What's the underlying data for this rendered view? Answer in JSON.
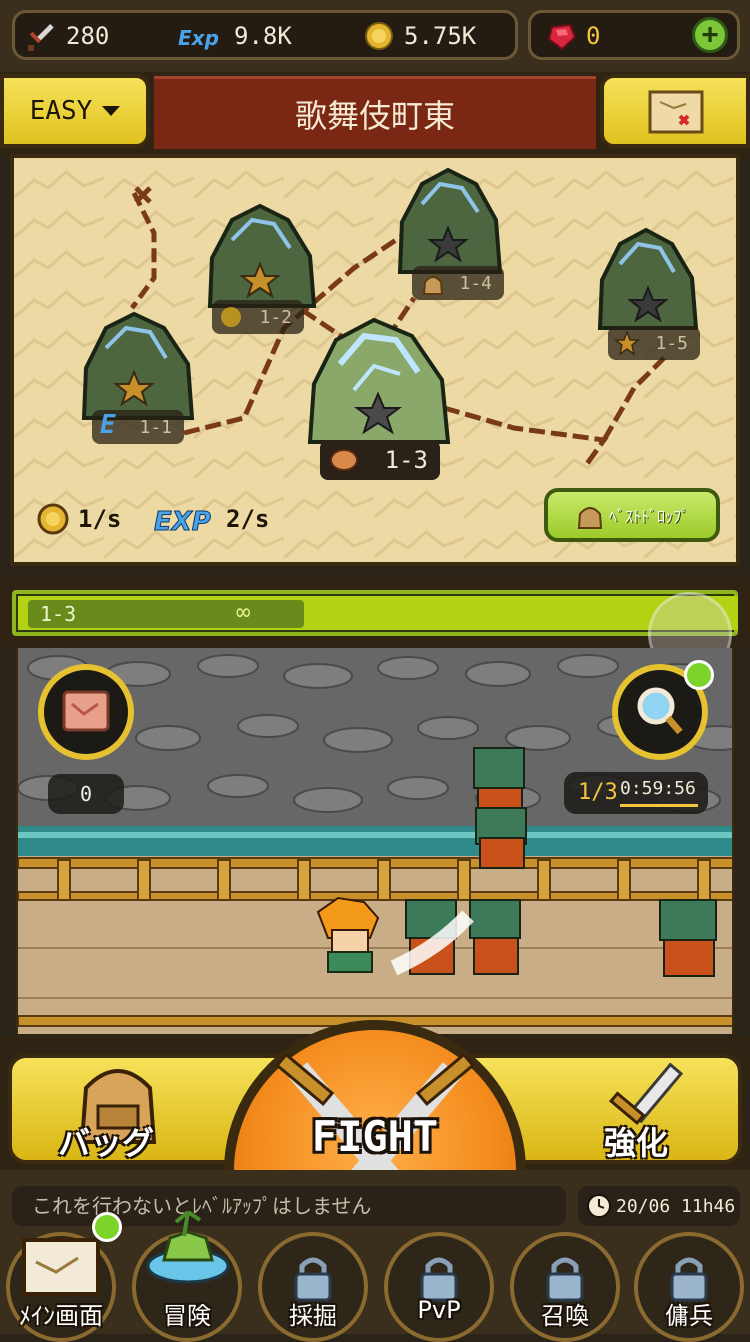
{
  "resources": {
    "attack": "280",
    "exp": "9.8K",
    "gold": "5.75K",
    "gems": "0",
    "attack_icon": "sword-icon",
    "exp_icon": "exp-icon",
    "gold_icon": "coin-icon",
    "gem_icon": "ruby-icon",
    "add_icon": "plus-icon"
  },
  "header": {
    "difficulty": "EASY",
    "area_title": "歌舞伎町東",
    "map_icon": "treasure-map-icon"
  },
  "map": {
    "nodes": [
      {
        "label": "1-1",
        "star": "gold-star",
        "badge": "E"
      },
      {
        "label": "1-2",
        "star": "gold-star",
        "badge": "coin"
      },
      {
        "label": "1-3",
        "star": "dark-star",
        "badge": "meat",
        "active": true
      },
      {
        "label": "1-4",
        "star": "dark-star",
        "badge": "bag"
      },
      {
        "label": "1-5",
        "star": "dark-star",
        "badge": "star"
      }
    ],
    "gold_rate": "1/s",
    "exp_rate": "2/s",
    "best_drop": "ﾍﾞｽﾄﾄﾞﾛｯﾌﾟ"
  },
  "progress": {
    "stage": "1-3",
    "infinite_symbol": "∞",
    "fill_percent": 100
  },
  "battle": {
    "meat_count": "0",
    "wave": "1/3",
    "timer": "0:59:56"
  },
  "actions": {
    "bag": "バッグ",
    "fight": "FIGHT",
    "upgrade": "強化"
  },
  "status": {
    "message": "これを行わないとﾚﾍﾞﾙｱｯﾌﾟはしません",
    "clock": "20/06 11h46"
  },
  "nav": [
    {
      "label": "ﾒｲﾝ画面",
      "locked": false,
      "notify": true
    },
    {
      "label": "冒険",
      "locked": false,
      "notify": false
    },
    {
      "label": "採掘",
      "locked": true,
      "notify": false
    },
    {
      "label": "PvP",
      "locked": true,
      "notify": false
    },
    {
      "label": "召喚",
      "locked": true,
      "notify": false
    },
    {
      "label": "傭兵",
      "locked": true,
      "notify": false
    }
  ],
  "colors": {
    "accent_yellow": "#e6c230",
    "title_red": "#7a2814",
    "progress_green": "#b4d214",
    "fight_orange": "#f38a1c"
  }
}
